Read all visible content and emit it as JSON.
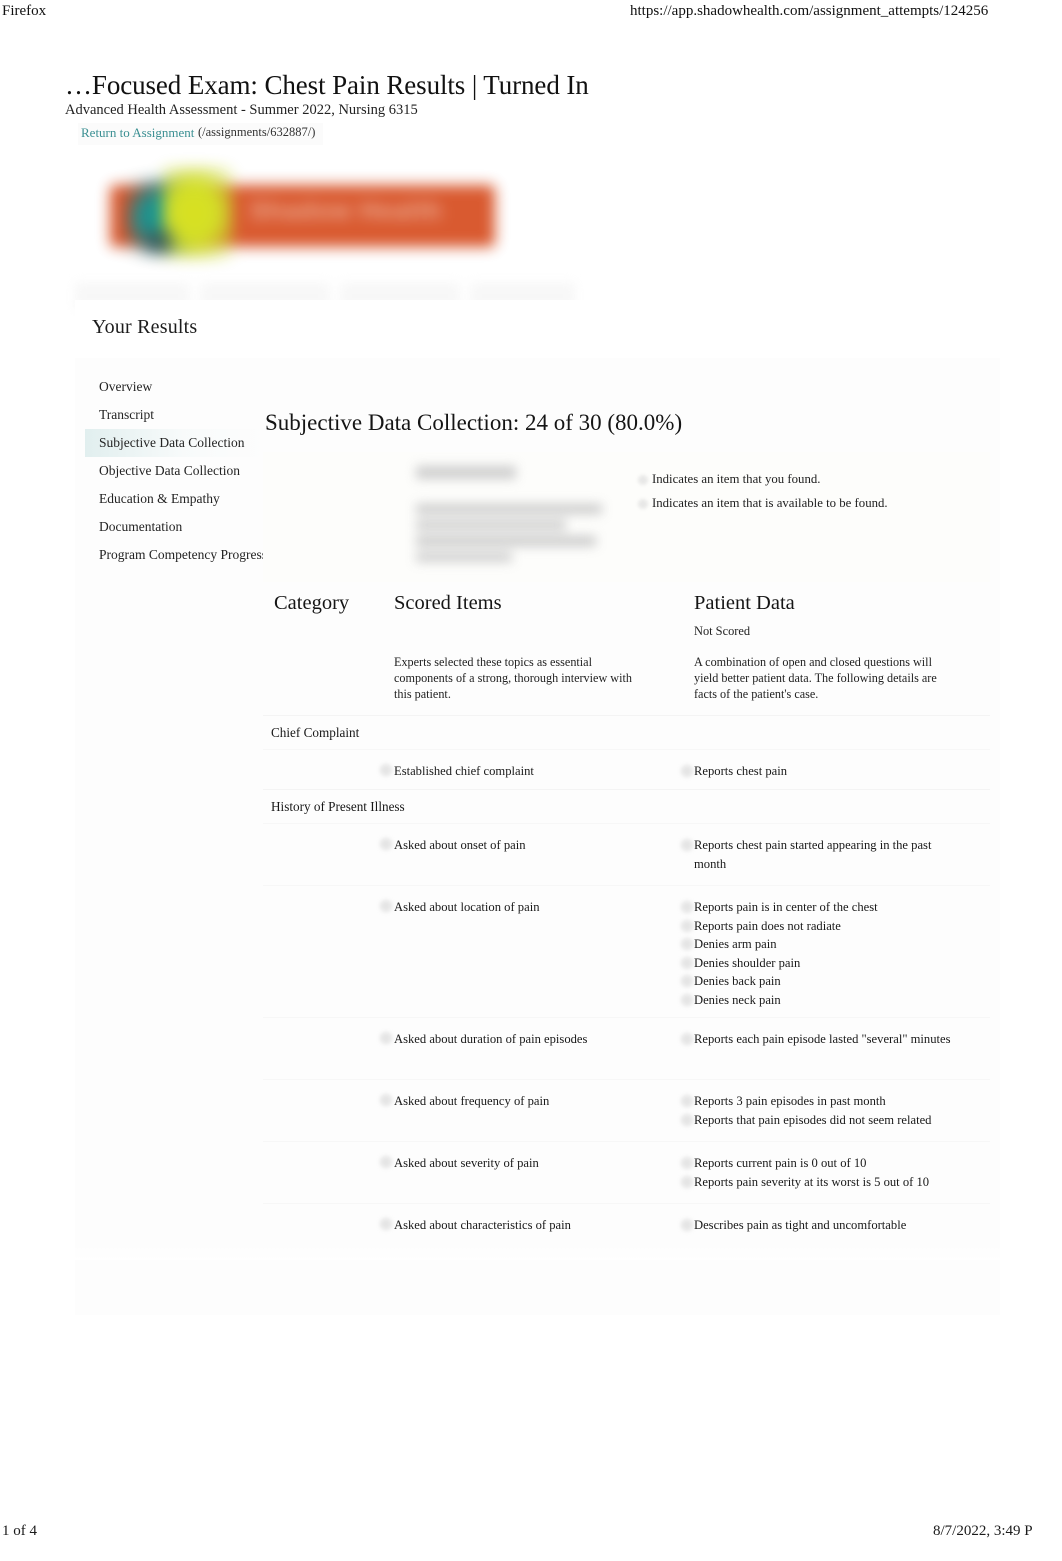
{
  "browser": {
    "app_name": "Firefox",
    "url": "https://app.shadowhealth.com/assignment_attempts/124256"
  },
  "print_footer": {
    "page_indicator": "1 of 4",
    "timestamp": "8/7/2022, 3:49 P"
  },
  "document": {
    "title": "…Focused Exam: Chest Pain Results | Turned In",
    "subtitle": "Advanced Health Assessment - Summer 2022, Nursing 6315",
    "return_link_label": "Return to Assignment",
    "return_link_url": "(/assignments/632887/)",
    "logo_text": "Shadow Health",
    "results_heading": "Your Results"
  },
  "colors": {
    "link_teal": "#3a8f92",
    "logo_orange": "#d8552a",
    "logo_teal": "#0f8f8d",
    "logo_green": "#d8e017",
    "active_nav": "#dcecec"
  },
  "sidebar": {
    "items": [
      {
        "label": "Overview",
        "active": false
      },
      {
        "label": "Transcript",
        "active": false
      },
      {
        "label": "Subjective Data Collection",
        "active": true
      },
      {
        "label": "Objective Data Collection",
        "active": false
      },
      {
        "label": "Education & Empathy",
        "active": false
      },
      {
        "label": "Documentation",
        "active": false
      },
      {
        "label": "Program Competency Progress",
        "active": false
      }
    ]
  },
  "main": {
    "section_heading": "Subjective Data Collection: 24 of 30 (80.0%)",
    "score": {
      "earned": 24,
      "total": 30,
      "percent": "80.0%"
    },
    "legend": [
      "Indicates an item that you found.",
      "Indicates an item that is available to be found."
    ],
    "columns": {
      "category": "Category",
      "scored_items": "Scored Items",
      "patient_data": "Patient Data",
      "not_scored": "Not Scored",
      "scored_items_desc": "Experts selected these topics as essential components of a strong, thorough interview with this patient.",
      "patient_data_desc": "A combination of open and closed questions will yield better patient data. The following details are facts of the patient's case."
    },
    "categories": [
      {
        "name": "Chief Complaint",
        "rows": [
          {
            "scored_item": "Established chief complaint",
            "patient_data": [
              "Reports chest pain"
            ]
          }
        ]
      },
      {
        "name": "History of Present Illness",
        "rows": [
          {
            "scored_item": "Asked about onset of pain",
            "patient_data": [
              "Reports chest pain started appearing in the past month"
            ]
          },
          {
            "scored_item": "Asked about location of pain",
            "patient_data": [
              "Reports pain is in center of the chest",
              "Reports pain does not radiate",
              "Denies arm pain",
              "Denies shoulder pain",
              "Denies back pain",
              "Denies neck pain"
            ]
          },
          {
            "scored_item": "Asked about duration of pain episodes",
            "patient_data": [
              "Reports each pain episode lasted \"several\" minutes"
            ]
          },
          {
            "scored_item": "Asked about frequency of pain",
            "patient_data": [
              "Reports 3 pain episodes in past month",
              "Reports that pain episodes did not seem related"
            ]
          },
          {
            "scored_item": "Asked about severity of pain",
            "patient_data": [
              "Reports current pain is 0 out of 10",
              "Reports pain severity at its worst is 5 out of 10"
            ]
          },
          {
            "scored_item": "Asked about characteristics of pain",
            "patient_data": [
              "Describes pain as tight and uncomfortable"
            ]
          }
        ]
      }
    ]
  }
}
